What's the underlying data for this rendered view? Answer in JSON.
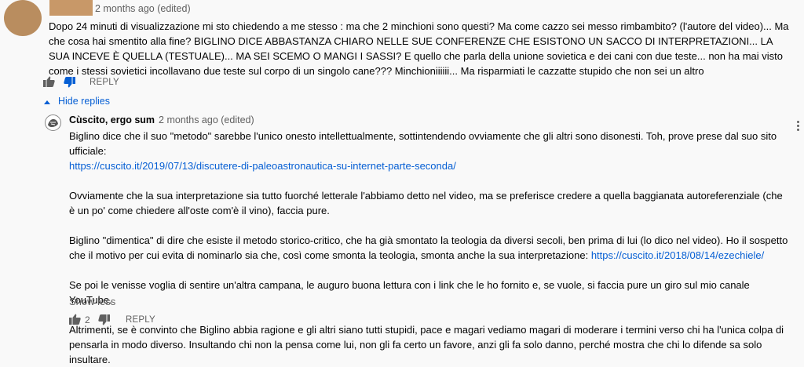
{
  "comment": {
    "time": "2 months ago (edited)",
    "text": "Dopo 24 minuti di visualizzazione mi sto chiedendo a me stesso : ma che 2 minchioni sono questi? Ma come cazzo sei messo rimbambito? (l'autore del video)... Ma che cosa hai smentito alla fine? BIGLINO DICE ABBASTANZA CHIARO NELLE SUE CONFERENZE CHE ESISTONO UN SACCO DI INTERPRETAZIONI... LA SUA INCEVE È QUELLA (TESTUALE)... MA SEI SCEMO O MANGI I SASSI? E quello che parla della unione sovietica e dei cani con due teste... non ha mai visto come i stessi sovietici incollavano due teste sul corpo di un singolo cane??? Minchioniiiiii... Ma risparmiati le cazzatte stupido che non sei un altro",
    "reply_label": "REPLY"
  },
  "hide_replies": "Hide replies",
  "reply": {
    "author": "Cùscito, ergo sum",
    "time": "2 months ago (edited)",
    "p1": "Biglino dice che il suo \"metodo\" sarebbe l'unico onesto intellettualmente, sottintendendo ovviamente che gli altri sono disonesti. Toh, prove prese dal suo sito ufficiale:",
    "link1": "https://cuscito.it/2019/07/13/discutere-di-paleoastronautica-su-internet-parte-seconda/",
    "p2": "Ovviamente che la sua interpretazione sia tutto fuorché letterale l'abbiamo detto nel video, ma se preferisce credere a quella baggianata autoreferenziale (che è un po' come chiedere all'oste com'è il vino), faccia pure.",
    "p3": "Biglino \"dimentica\" di dire che esiste il metodo storico-critico, che ha già smontato la teologia da diversi secoli, ben prima di lui (lo dico nel video). Ho il sospetto che il motivo per cui evita di nominarlo sia che, così come smonta la teologia, smonta anche la sua interpretazione:",
    "link2": "https://cuscito.it/2018/08/14/ezechiele/",
    "p4": "Se poi le venisse voglia di sentire un'altra campana, le auguro buona lettura con i link che le ho fornito e, se vuole, si faccia pure un giro sul mio canale YouTube.",
    "p5": "Altrimenti, se è convinto che Biglino abbia ragione e gli altri siano tutti stupidi, pace e magari vediamo magari di moderare i termini verso chi ha l'unica colpa di pensarla in modo diverso. Insultando chi non la pensa come lui, non gli fa certo un favore, anzi gli fa solo danno, perché mostra che chi lo difende sa solo insultare.",
    "show_less": "Show less",
    "like_count": "2",
    "reply_label": "REPLY"
  },
  "icons": {
    "like": "thumbs-up-icon",
    "dislike": "thumbs-down-icon",
    "chevron": "chevron-up-icon",
    "menu": "kebab-menu-icon"
  },
  "colors": {
    "link": "#065fd4",
    "meta": "#606060",
    "avatar": "#b98d5f"
  }
}
